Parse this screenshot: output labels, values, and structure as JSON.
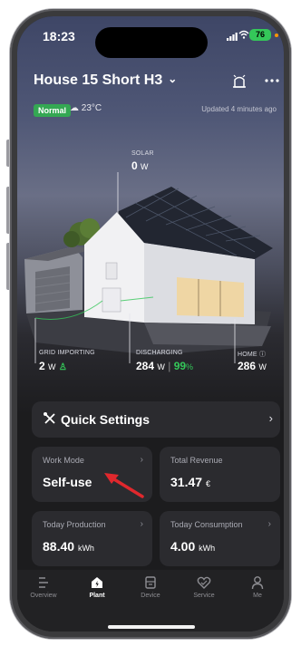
{
  "status_bar": {
    "time": "18:23",
    "battery": "76"
  },
  "header": {
    "plant_name": "House 15 Short H3",
    "status_badge": "Normal",
    "temperature": "23°C",
    "updated": "Updated 4 minutes ago"
  },
  "energy": {
    "solar": {
      "label": "SOLAR",
      "value": "0",
      "unit": "W"
    },
    "grid": {
      "label": "GRID IMPORTING",
      "value": "2",
      "unit": "W"
    },
    "battery": {
      "label": "DISCHARGING",
      "value": "284",
      "unit": "W",
      "soc": "99",
      "soc_unit": "%"
    },
    "home": {
      "label": "HOME",
      "value": "286",
      "unit": "W"
    }
  },
  "quick_settings": {
    "label": "Quick Settings"
  },
  "cards": {
    "work_mode": {
      "label": "Work Mode",
      "value": "Self-use"
    },
    "total_revenue": {
      "label": "Total Revenue",
      "value": "31.47",
      "unit": "€"
    },
    "today_production": {
      "label": "Today Production",
      "value": "88.40",
      "unit": "kWh"
    },
    "today_consumption": {
      "label": "Today Consumption",
      "value": "4.00",
      "unit": "kWh"
    }
  },
  "tabs": [
    "Overview",
    "Plant",
    "Device",
    "Service",
    "Me"
  ],
  "active_tab": "Plant",
  "colors": {
    "accent_green": "#34c759",
    "badge_green": "#34a853",
    "card_bg": "#2b2b2f",
    "arrow_red": "#e0282d"
  }
}
